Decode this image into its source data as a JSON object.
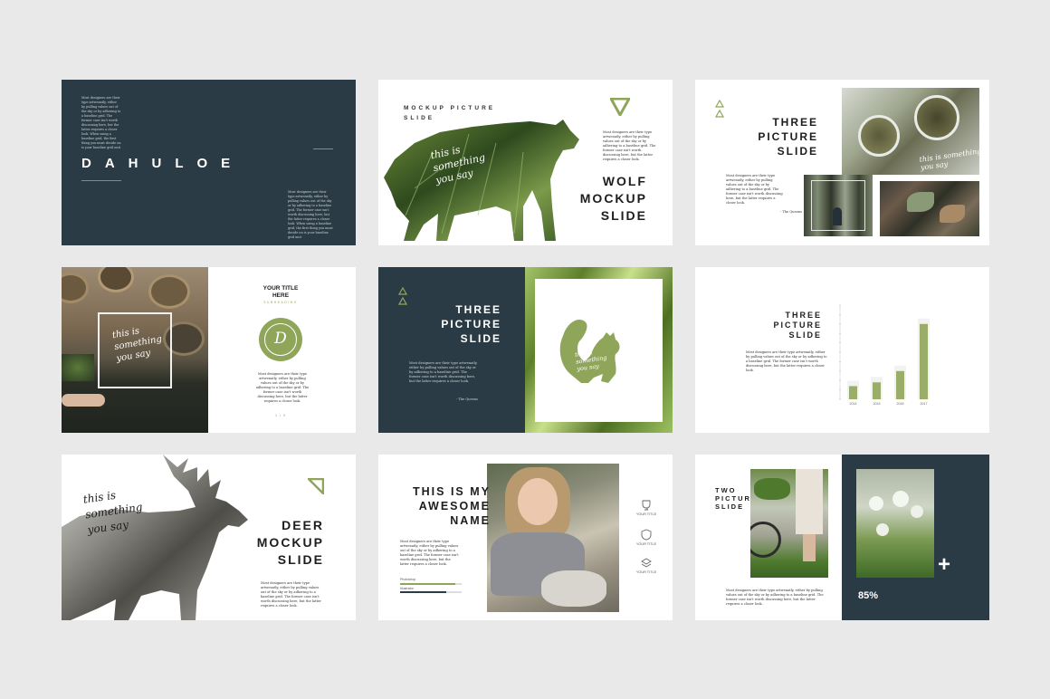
{
  "colors": {
    "dark": "#2b3b45",
    "green": "#8fa65a",
    "background": "#e9e9ea"
  },
  "s1": {
    "title": "DAHULOE",
    "p1": "Most designers are their type artwenatly, either by pulling values out of the sky or by adhering to a baseline grid. The former case isn't worth discussing here, but the latter requires a closer look. When using a baseline grid, the first thing you must decide on is your baseline grid unit",
    "p2": "Most designers are their type artwenatly, either by pulling values out of the sky or by adhering to a baseline grid. The former case isn't worth discussing here, but the latter requires a closer look. When using a baseline grid, the first thing you must decide on is your baseline grid unit"
  },
  "s2": {
    "kicker": "MOCKUP PICTURE SLIDE",
    "title1": "WOLF",
    "title2": "MOCKUP",
    "title3": "SLIDE",
    "script": "this is something you say",
    "para": "Most designers are their type artwenatly, either by pulling values out of the sky or by adhering to a baseline grid. The former case isn't worth discussing here, but the latter requires a closer look."
  },
  "s3": {
    "title1": "THREE",
    "title2": "PICTURE",
    "title3": "SLIDE",
    "para": "Most designers are their type artwenatly, either by pulling values out of the sky or by adhering to a baseline grid. The former case isn't worth discussing here, but the latter requires a closer look.",
    "quote": "- The Queens",
    "script": "this is something you say"
  },
  "s4": {
    "title1": "YOUR TITLE",
    "title2": "HERE",
    "sub": "SUBHEADING",
    "letter": "D",
    "script": "this is something you say",
    "para": "Most designers are their type artwenatly, either by pulling values out of the sky or by adhering to a baseline grid. The former case isn't worth discussing here, but the latter requires a closer look.",
    "page": "1 / 9"
  },
  "s5": {
    "title1": "THREE",
    "title2": "PICTURE",
    "title3": "SLIDE",
    "para": "Most designers are their type artwenatly, either by pulling values out of the sky or by adhering to a baseline grid. The former case isn't worth discussing here, but the latter requires a closer look.",
    "quote": "- The Queens",
    "script": "this is something you say"
  },
  "s6": {
    "title1": "THREE",
    "title2": "PICTURE",
    "title3": "SLIDE",
    "para": "Most designers are their type artwenatly, either by pulling values out of the sky or by adhering to a baseline grid. The former case isn't worth discussing here, but the latter requires a closer look."
  },
  "chart_data": {
    "type": "bar",
    "categories": [
      "2014",
      "2015",
      "2016",
      "2017"
    ],
    "values": [
      14,
      18,
      30,
      80
    ],
    "ylim": [
      0,
      100
    ]
  },
  "s7": {
    "script": "this is something you say",
    "title1": "DEER",
    "title2": "MOCKUP",
    "title3": "SLIDE",
    "para": "Most designers are their type artwenatly, either by pulling values out of the sky or by adhering to a baseline grid. The former case isn't worth discussing here, but the latter requires a closer look."
  },
  "s8": {
    "title1": "THIS IS MY",
    "title2": "AWESOME",
    "title3": "NAME",
    "para": "Most designers are their type artwenatly, either by pulling values out of the sky or by adhering to a baseline grid. The former case isn't worth discussing here, but the latter requires a closer look.",
    "bar1": "Photoshop",
    "bar2": "Illustrator",
    "icon1": "YOUR TITLE",
    "icon2": "YOUR TITLE",
    "icon3": "YOUR TITLE",
    "bar1_level": 0.9,
    "bar2_level": 0.75
  },
  "s9": {
    "title1": "TWO",
    "title2": "PICTURE",
    "title3": "SLIDE",
    "para": "Most designers are their type artwenatly, either by pulling values out of the sky or by adhering to a baseline grid. The former case isn't worth discussing here, but the latter requires a closer look.",
    "percent": "85%",
    "plus": "+"
  }
}
